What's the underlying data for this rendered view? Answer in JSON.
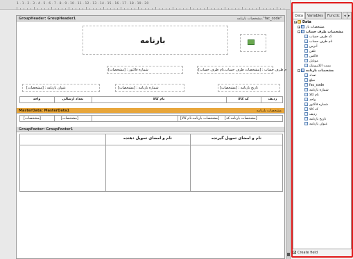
{
  "ruler": {
    "numbers": "1 · 1 · 2 · 3 · 4 · 5 · 6 · 7 · 8 · 9 · 10 · 11 · 12 · 13 · 14 · 15 · 16 · 17 · 18 · 19 · 20"
  },
  "group_header": {
    "title": "GroupHeader: GroupHeader1",
    "right_expr": "مشخصات بارنامه.\"fac_code\"",
    "report_title": "بارنامه",
    "account_label": "نام طرف حساب : [مشخصات طرف حساب.نام طرف حساب]",
    "invoice_no": "شماره فاکتور : [مشخصات]",
    "bill_date": "تاریخ بارنامه : [مشخصات]",
    "bill_no": "شماره بارنامه : [مشخصات]",
    "bill_title": "عنوان بارنامه : [مشخصات]",
    "col_row": "ردیف",
    "col_code": "کد کالا",
    "col_name": "نام کالا",
    "col_count": "تعداد ارسالی",
    "col_unit": "واحد"
  },
  "master_data": {
    "title": "MasterData: MasterData1",
    "right_label": "مشخصات بارنامه",
    "f1": "[مشخصات بارنامه.کد]",
    "f2": "[مشخصات بارنامه.نام کالا]",
    "f3": "[مشخصات]",
    "f4": "[مشخصات]"
  },
  "group_footer": {
    "title": "GroupFooter: GroupFooter1",
    "receiver": "نام و امضای تحویل گیرنده",
    "deliverer": "نام و امضای تحویل دهنده"
  },
  "panel": {
    "tabs": [
      "Data",
      "Variables",
      "Functic"
    ],
    "tree_root": "Data",
    "ds1": "مشخصات بار",
    "ds2": "مشخصات طرف حساب",
    "ds2_fields": [
      "کد طرف حساب",
      "نام طرف حساب",
      "آدرس",
      "تلفن",
      "فاکس",
      "موبایل",
      "پست الکترونیک"
    ],
    "ds3": "مشخصات بارنامه",
    "ds3_fields": [
      "تعداد",
      "مبلغ",
      "fac_code",
      "شماره بارنامه",
      "نام کالا",
      "واحد",
      "شماره فاکتور",
      "کد کالا",
      "ردیف",
      "تاریخ بارنامه",
      "عنوان بارنامه"
    ],
    "create_field": "Create field"
  },
  "colors": {
    "accent_frame": "#e01919",
    "master_band": "#e8a63b"
  }
}
